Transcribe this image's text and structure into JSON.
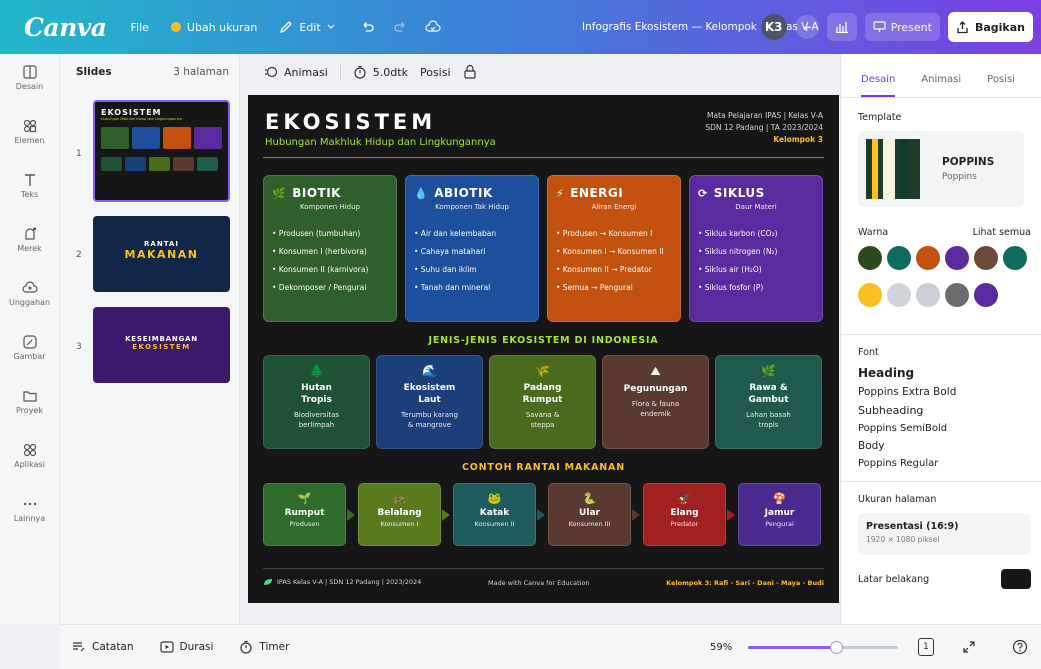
{
  "app": {
    "logo": "Canva",
    "file": "File",
    "resize": "Ubah ukuran",
    "edit": "Edit",
    "doc_title": "Infografis Ekosistem — Kelompok 3 Kelas V-A",
    "avatar": "K3",
    "present": "Present",
    "share": "Bagikan"
  },
  "rail": [
    {
      "label": "Desain",
      "icon": "layout-icon"
    },
    {
      "label": "Elemen",
      "icon": "elements-icon"
    },
    {
      "label": "Teks",
      "icon": "text-icon"
    },
    {
      "label": "Merek",
      "icon": "brand-icon"
    },
    {
      "label": "Unggahan",
      "icon": "upload-icon"
    },
    {
      "label": "Gambar",
      "icon": "draw-icon"
    },
    {
      "label": "Proyek",
      "icon": "folder-icon"
    },
    {
      "label": "Aplikasi",
      "icon": "apps-icon"
    },
    {
      "label": "Lainnya",
      "icon": "more-icon"
    }
  ],
  "slides_panel": {
    "title": "Slides",
    "count": "3 halaman",
    "items": [
      {
        "num": "1",
        "title": "EKOSISTEM",
        "subtitle": "Hubungan Makhluk Hidup dan Lingkungannya"
      },
      {
        "num": "2",
        "line1": "RANTAI",
        "line2": "MAKANAN"
      },
      {
        "num": "3",
        "line1": "KESEIMBANGAN",
        "line2": "EKOSISTEM"
      }
    ]
  },
  "toolbar": {
    "animation": "Animasi",
    "duration": "5.0dtk",
    "position": "Posisi"
  },
  "slide": {
    "title": "EKOSISTEM",
    "subtitle": "Hubungan Makhluk Hidup dan Lingkungannya",
    "meta1": "Mata Pelajaran IPAS | Kelas V-A",
    "meta2": "SDN 12 Padang | TA 2023/2024",
    "group": "Kelompok 3",
    "categories": [
      {
        "title": "BIOTIK",
        "sub": "Komponen Hidup",
        "color": "#2f5f2a",
        "items": [
          "Produsen (tumbuhan)",
          "Konsumen I (herbivora)",
          "Konsumen II (karnivora)",
          "Dekomposer / Pengurai"
        ]
      },
      {
        "title": "ABIOTIK",
        "sub": "Komponen Tak Hidup",
        "color": "#1e4f9c",
        "items": [
          "Air dan kelembaban",
          "Cahaya matahari",
          "Suhu dan iklim",
          "Tanah dan mineral"
        ]
      },
      {
        "title": "ENERGI",
        "sub": "Aliran Energi",
        "color": "#c2510f",
        "items": [
          "Produsen → Konsumen I",
          "Konsumen I → Konsumen II",
          "Konsumen II → Predator",
          "Semua → Pengurai"
        ]
      },
      {
        "title": "SIKLUS",
        "sub": "Daur Materi",
        "color": "#5b2a9e",
        "items": [
          "Siklus karbon (CO₂)",
          "Siklus nitrogen (N₂)",
          "Siklus air (H₂O)",
          "Siklus fosfor (P)"
        ]
      }
    ],
    "eco_title": "JENIS-JENIS EKOSISTEM DI INDONESIA",
    "ecosystems": [
      {
        "t": "Hutan\nTropis",
        "d": "Biodiversitas\nberlimpah",
        "color": "#1f5234"
      },
      {
        "t": "Ekosistem\nLaut",
        "d": "Terumbu karang\n& mangrove",
        "color": "#1b3f7a"
      },
      {
        "t": "Padang\nRumput",
        "d": "Savana &\nsteppa",
        "color": "#4a6a1e"
      },
      {
        "t": "Pegunungan",
        "d": "Flora & fauna\nendemik",
        "color": "#5a3a30"
      },
      {
        "t": "Rawa &\nGambut",
        "d": "Lahan basah\ntropis",
        "color": "#1e5a4e"
      }
    ],
    "chain_title": "CONTOH RANTAI MAKANAN",
    "chain": [
      {
        "t": "Rumput",
        "d": "Produsen",
        "color": "#2f6b2a"
      },
      {
        "t": "Belalang",
        "d": "Konsumen I",
        "color": "#5a7a1e"
      },
      {
        "t": "Katak",
        "d": "Konsumen II",
        "color": "#1e5a5e"
      },
      {
        "t": "Ular",
        "d": "Konsumen III",
        "color": "#5a3a30"
      },
      {
        "t": "Elang",
        "d": "Predator",
        "color": "#a32020"
      },
      {
        "t": "Jamur",
        "d": "Pengurai",
        "color": "#4a2a8e"
      }
    ],
    "footer_left": "IPAS Kelas V-A | SDN 12 Padang | 2023/2024",
    "footer_mid": "Made with Canva for Education",
    "footer_right": "Kelompok 3: Rafi - Sari - Dani - Maya - Budi"
  },
  "right_panel": {
    "tabs": [
      "Desain",
      "Animasi",
      "Posisi"
    ],
    "template_label": "Template",
    "template_name": "POPPINS",
    "template_sub": "Poppins",
    "color_label": "Warna",
    "see_all": "Lihat semua",
    "swatches": [
      "#2d4a1f",
      "#0f6b5e",
      "#c2510f",
      "#5b2a9e",
      "#6b4a3a",
      "#0f6b5e",
      "#fbbf24",
      "#d1d5db",
      "#cbd0d6",
      "#6b6b6b",
      "#5b2a9e"
    ],
    "font_label": "Font",
    "fonts": [
      "Heading",
      "Poppins Extra Bold",
      "Subheading",
      "Poppins SemiBold",
      "Body",
      "Poppins Regular"
    ],
    "size_label": "Ukuran halaman",
    "size_name": "Presentasi (16:9)",
    "size_px": "1920 × 1080 piksel",
    "bg_label": "Latar belakang"
  },
  "bottom": {
    "notes": "Catatan",
    "duration": "Durasi",
    "timer": "Timer",
    "zoom": "59%",
    "page": "1",
    "zoom_level": 0.59
  }
}
